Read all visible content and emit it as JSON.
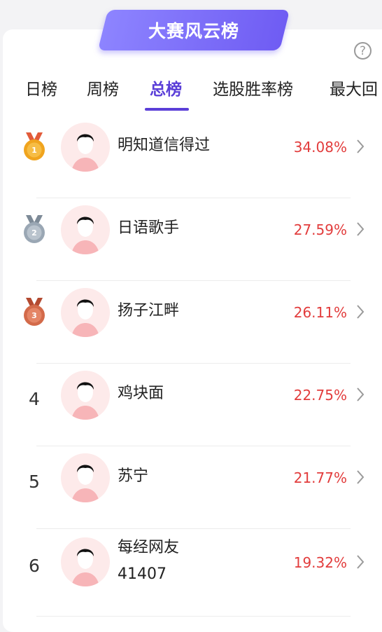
{
  "banner": {
    "title": "大赛风云榜"
  },
  "help": {
    "icon": "help-icon",
    "glyph": "?"
  },
  "tabs": [
    {
      "label": "日榜"
    },
    {
      "label": "周榜"
    },
    {
      "label": "总榜",
      "active": true
    },
    {
      "label": "选股胜率榜"
    },
    {
      "label": "最大回"
    }
  ],
  "rows": [
    {
      "rank": "1",
      "name": "明知道信得过",
      "percent": "34.08%",
      "medal": "gold"
    },
    {
      "rank": "2",
      "name": "日语歌手",
      "percent": "27.59%",
      "medal": "silver"
    },
    {
      "rank": "3",
      "name": "扬子江畔",
      "percent": "26.11%",
      "medal": "bronze"
    },
    {
      "rank": "4",
      "name": "鸡块面",
      "percent": "22.75%"
    },
    {
      "rank": "5",
      "name": "苏宁",
      "percent": "21.77%"
    },
    {
      "rank": "6",
      "name": "每经网友",
      "name2": "41407",
      "percent": "19.32%"
    }
  ],
  "colors": {
    "accent": "#5b3fd8",
    "percent": "#e23c3c",
    "gold": "#f0a41e",
    "silver": "#9aa7b4",
    "bronze": "#d36a4a"
  }
}
